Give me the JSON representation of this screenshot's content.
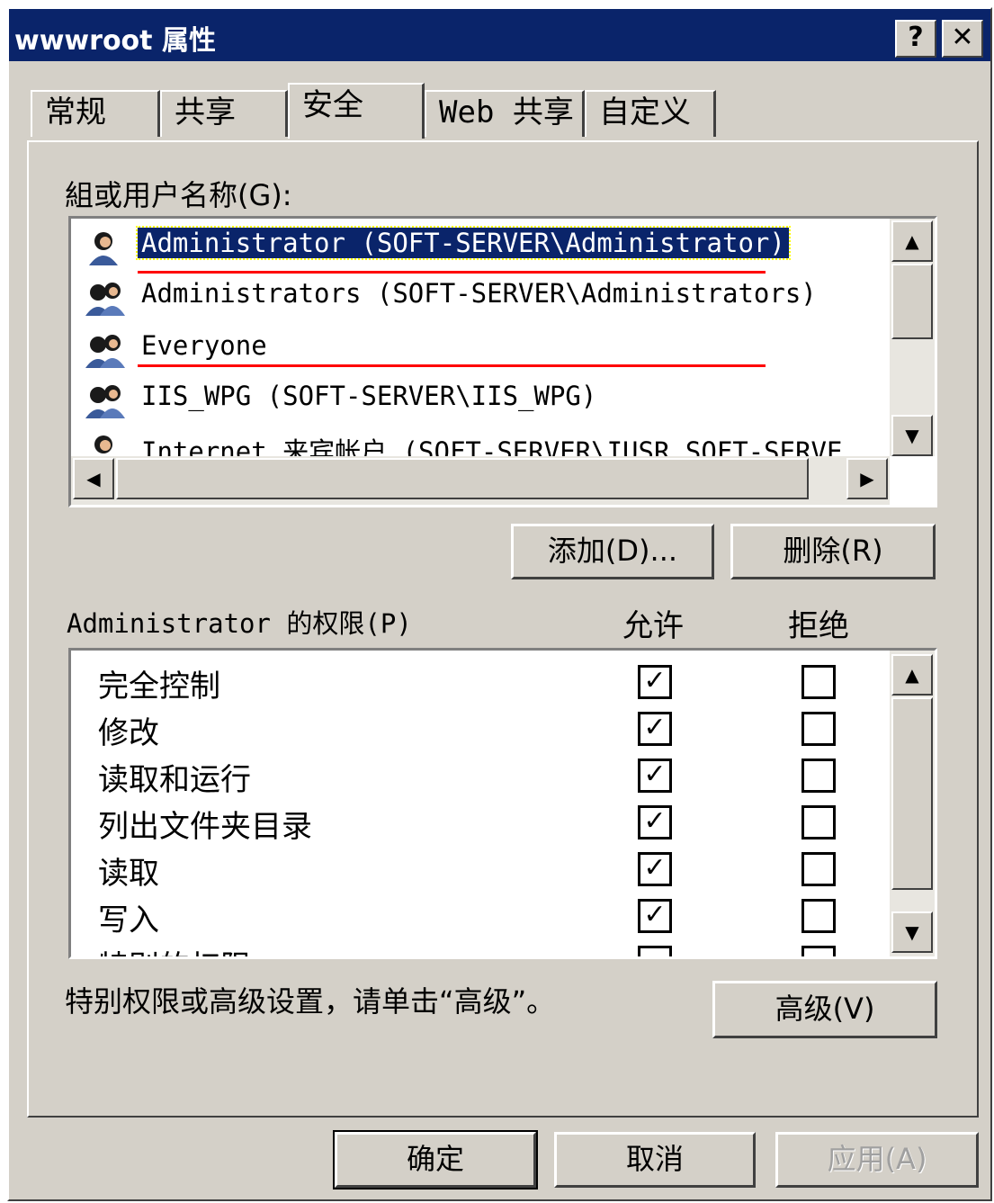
{
  "window": {
    "title": "wwwroot 属性",
    "help_btn": "?",
    "close_btn": "✕"
  },
  "tabs": [
    {
      "label": "常规"
    },
    {
      "label": "共享"
    },
    {
      "label": "安全"
    },
    {
      "label": "Web 共享"
    },
    {
      "label": "自定义"
    }
  ],
  "security": {
    "users_label": "組或用户名称(G):",
    "users": [
      {
        "name": "Administrator (SOFT-SERVER\\Administrator)",
        "selected": true,
        "icon": "single-user-icon"
      },
      {
        "name": "Administrators (SOFT-SERVER\\Administrators)",
        "icon": "group-users-icon"
      },
      {
        "name": "Everyone",
        "icon": "group-users-icon"
      },
      {
        "name": "IIS_WPG (SOFT-SERVER\\IIS_WPG)",
        "icon": "group-users-icon"
      },
      {
        "name": "Internet 来宾帐户 (SOFT-SERVER\\IUSR_SOFT-SERVE",
        "icon": "single-user-icon"
      }
    ],
    "add_button": "添加(D)...",
    "remove_button": "删除(R)",
    "perm_label": "Administrator 的权限(P)",
    "allow_header": "允许",
    "deny_header": "拒绝",
    "permissions": [
      {
        "name": "完全控制",
        "allow": true,
        "deny": false
      },
      {
        "name": "修改",
        "allow": true,
        "deny": false
      },
      {
        "name": "读取和运行",
        "allow": true,
        "deny": false
      },
      {
        "name": "列出文件夹目录",
        "allow": true,
        "deny": false
      },
      {
        "name": "读取",
        "allow": true,
        "deny": false
      },
      {
        "name": "写入",
        "allow": true,
        "deny": false
      },
      {
        "name": "特别的权限",
        "allow": false,
        "deny": false
      }
    ],
    "advanced_hint": "特别权限或高级设置，请单击“高级”。",
    "advanced_button": "高级(V)"
  },
  "footer": {
    "ok": "确定",
    "cancel": "取消",
    "apply": "应用(A)"
  },
  "colors": {
    "title_bar": "#0a246a",
    "face": "#d4d0c8",
    "annotation": "#ff0000"
  }
}
